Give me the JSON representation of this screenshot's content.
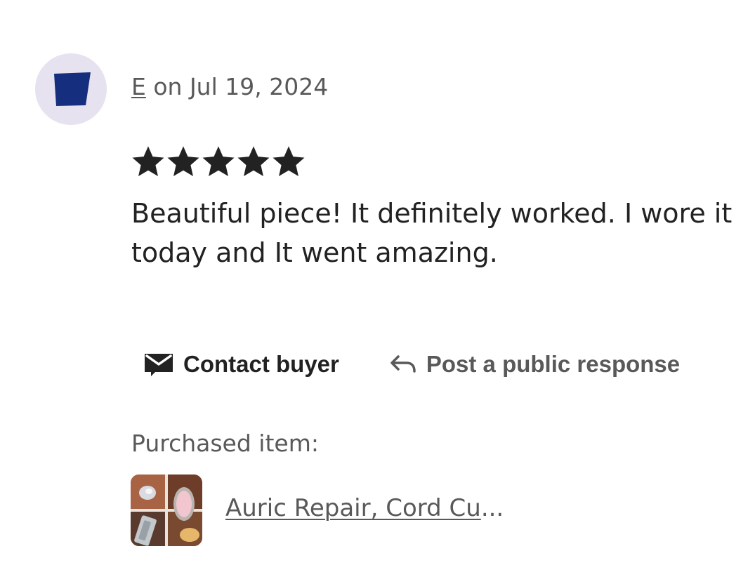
{
  "review": {
    "reviewer_name": "E",
    "date_text": "on Jul 19, 2024",
    "rating": 5,
    "rating_max": 5,
    "text": "Beautiful piece! It definitely worked. I wore it today and It went amazing."
  },
  "actions": {
    "contact_label": "Contact buyer",
    "respond_label": "Post a public response"
  },
  "purchased": {
    "label": "Purchased item:",
    "item_title": "Auric Repair, Cord Cu",
    "ellipsis": "..."
  },
  "icons": {
    "avatar": "blue-shape-avatar-icon",
    "star": "star-icon",
    "contact": "envelope-icon",
    "respond": "reply-arrow-icon"
  },
  "colors": {
    "text_primary": "#222222",
    "text_secondary": "#595959",
    "avatar_bg": "#e6e2ef",
    "avatar_shape": "#152f7e"
  }
}
